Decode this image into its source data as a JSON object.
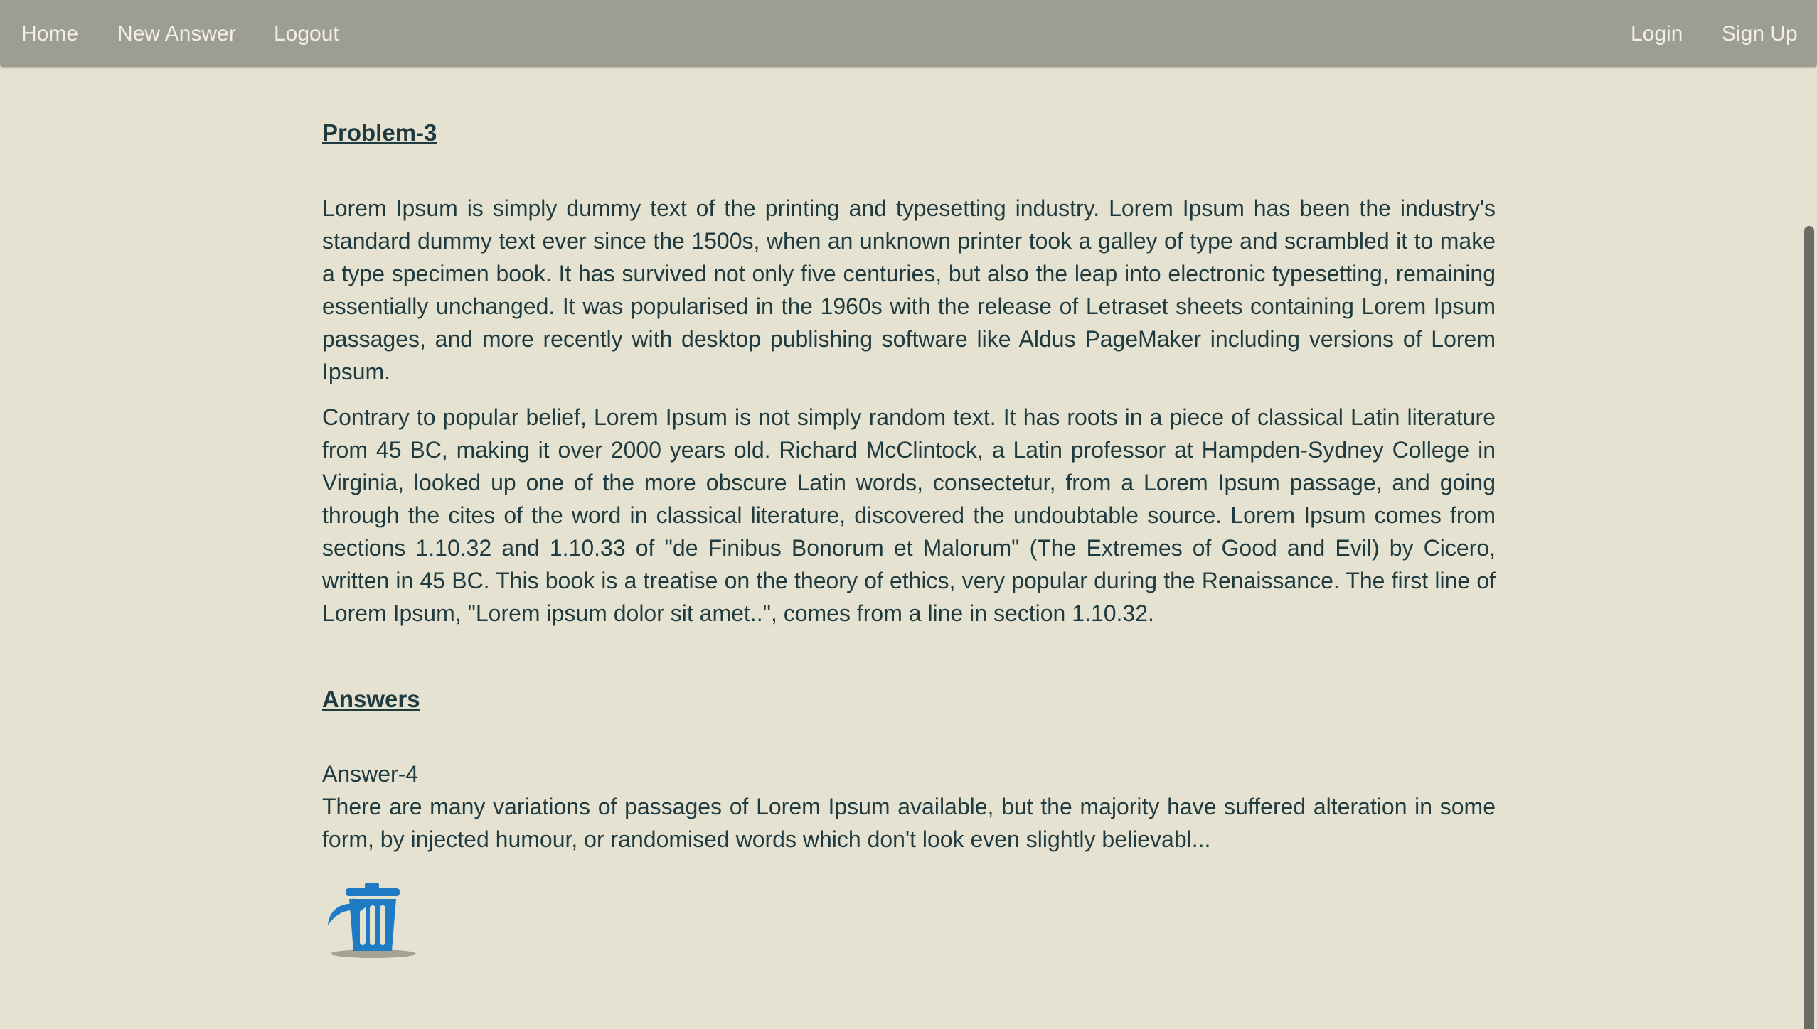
{
  "navbar": {
    "left_links": [
      "Home",
      "New Answer",
      "Logout"
    ],
    "right_links": [
      "Login",
      "Sign Up"
    ]
  },
  "problem": {
    "title": "Problem-3",
    "paragraphs": [
      "Lorem Ipsum is simply dummy text of the printing and typesetting industry. Lorem Ipsum has been the industry's standard dummy text ever since the 1500s, when an unknown printer took a galley of type and scrambled it to make a type specimen book. It has survived not only five centuries, but also the leap into electronic typesetting, remaining essentially unchanged. It was popularised in the 1960s with the release of Letraset sheets containing Lorem Ipsum passages, and more recently with desktop publishing software like Aldus PageMaker including versions of Lorem Ipsum.",
      "Contrary to popular belief, Lorem Ipsum is not simply random text. It has roots in a piece of classical Latin literature from 45 BC, making it over 2000 years old. Richard McClintock, a Latin professor at Hampden-Sydney College in Virginia, looked up one of the more obscure Latin words, consectetur, from a Lorem Ipsum passage, and going through the cites of the word in classical literature, discovered the undoubtable source. Lorem Ipsum comes from sections 1.10.32 and 1.10.33 of \"de Finibus Bonorum et Malorum\" (The Extremes of Good and Evil) by Cicero, written in 45 BC. This book is a treatise on the theory of ethics, very popular during the Renaissance. The first line of Lorem Ipsum, \"Lorem ipsum dolor sit amet..\", comes from a line in section 1.10.32."
    ]
  },
  "answers": {
    "heading": "Answers",
    "items": [
      {
        "title": "Answer-4",
        "excerpt": "There are many variations of passages of Lorem Ipsum available, but the majority have suffered alteration in some form, by injected humour, or randomised words which don't look even slightly believabl...",
        "delete_icon": "trash-icon"
      }
    ]
  },
  "colors": {
    "background": "#e5e2d2",
    "navbar": "#9e9d91",
    "nav_text": "#f1efe6",
    "text": "#1f3b3f",
    "trash_icon": "#1e7bc4"
  }
}
